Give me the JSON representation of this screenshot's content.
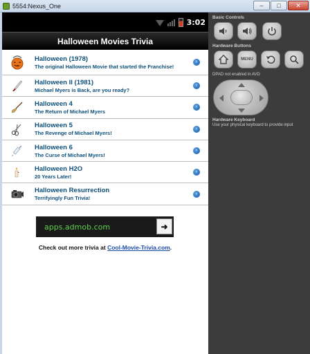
{
  "window": {
    "title": "5554:Nexus_One",
    "minimize": "–",
    "maximize": "□",
    "close": "✕"
  },
  "statusbar": {
    "time": "3:02"
  },
  "app": {
    "title": "Halloween Movies Trivia"
  },
  "movies": [
    {
      "title": "Halloween (1978)",
      "subtitle": "The original Halloween Movie that started the Franchise!",
      "icon": "pumpkin-bucket-icon"
    },
    {
      "title": "Halloween II (1981)",
      "subtitle": "Michael Myers is Back, are you ready?",
      "icon": "knife-icon"
    },
    {
      "title": "Halloween 4",
      "subtitle": "The Return of Michael Myers",
      "icon": "broom-icon"
    },
    {
      "title": "Halloween 5",
      "subtitle": "The Revenge of Michael Myers!",
      "icon": "scissors-icon"
    },
    {
      "title": "Halloween 6",
      "subtitle": "The Curse of Michael Myers!",
      "icon": "syringe-icon"
    },
    {
      "title": "Halloween H2O",
      "subtitle": "20 Years Later!",
      "icon": "candle-icon"
    },
    {
      "title": "Halloween Resurrection",
      "subtitle": "Terrifyingly Fun Trivia!",
      "icon": "camera-icon"
    }
  ],
  "ad": {
    "text": "apps.admob.com",
    "arrow": "➜"
  },
  "footer": {
    "prefix": "Check out more trivia at ",
    "link": "Cool-Movie-Trivia.com",
    "suffix": "."
  },
  "panel": {
    "basic_controls": "Basic Controls",
    "hardware_buttons": "Hardware Buttons",
    "menu_label": "MENU",
    "dpad_note": "DPAD not enabled in AVD",
    "keyboard_title": "Hardware Keyboard",
    "keyboard_note": "Use your physical keyboard to provide input"
  },
  "colors": {
    "link": "#0d4f7a",
    "ad_text": "#5fd04a"
  }
}
